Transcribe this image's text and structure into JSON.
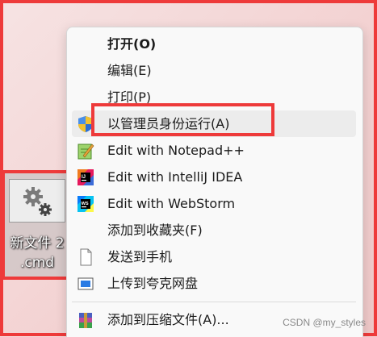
{
  "desktop_file": {
    "name_line1": "新文件 2",
    "name_line2": ".cmd",
    "icon": "gears-icon"
  },
  "context_menu": {
    "items": [
      {
        "label": "打开(O)",
        "bold": true,
        "icon": ""
      },
      {
        "label": "编辑(E)",
        "bold": false,
        "icon": ""
      },
      {
        "label": "打印(P)",
        "bold": false,
        "icon": ""
      },
      {
        "label": "以管理员身份运行(A)",
        "bold": false,
        "icon": "uac-shield-icon"
      },
      {
        "label": "Edit with Notepad++",
        "bold": false,
        "icon": "notepad-plus-plus-icon"
      },
      {
        "label": "Edit with IntelliJ IDEA",
        "bold": false,
        "icon": "intellij-idea-icon"
      },
      {
        "label": "Edit with WebStorm",
        "bold": false,
        "icon": "webstorm-icon"
      },
      {
        "label": "添加到收藏夹(F)",
        "bold": false,
        "icon": ""
      },
      {
        "label": "发送到手机",
        "bold": false,
        "icon": "document-icon"
      },
      {
        "label": "上传到夸克网盘",
        "bold": false,
        "icon": "quark-cloud-icon"
      },
      {
        "label": "添加到压缩文件(A)...",
        "bold": false,
        "icon": "winrar-icon"
      }
    ]
  },
  "watermark": "CSDN @my_styles",
  "colors": {
    "highlight_border": "#ee3a3a",
    "menu_background": "#f9f9f9"
  }
}
